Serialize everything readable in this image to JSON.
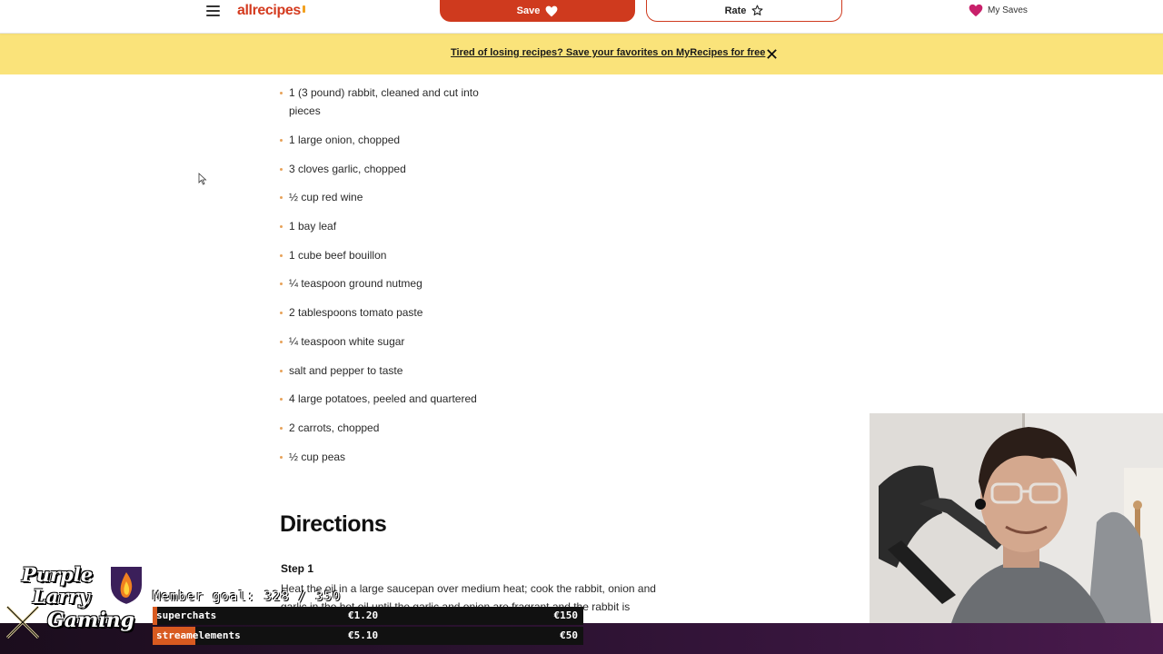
{
  "header": {
    "brand": "allrecipes",
    "save_label": "Save",
    "rate_label": "Rate",
    "my_saves_label": "My Saves"
  },
  "banner": {
    "text": "Tired of losing recipes? Save your favorites on MyRecipes for free"
  },
  "ingredients": [
    "1 (3 pound) rabbit, cleaned and cut into pieces",
    "1 large onion, chopped",
    "3 cloves garlic, chopped",
    "½ cup red wine",
    "1 bay leaf",
    "1 cube beef bouillon",
    "¼ teaspoon ground nutmeg",
    "2 tablespoons tomato paste",
    "¼ teaspoon white sugar",
    "salt and pepper to taste",
    "4 large potatoes, peeled and quartered",
    "2 carrots, chopped",
    "½ cup peas"
  ],
  "directions": {
    "title": "Directions",
    "step1_label": "Step 1",
    "step1_text": "Heat the oil in a large saucepan over medium heat; cook the rabbit, onion and garlic in the hot oil until the garlic and onion are fragrant and the rabbit is"
  },
  "stream": {
    "logo_line1": "Purple",
    "logo_line2": "Larry",
    "logo_line3": "Gaming",
    "member_goal": "Member goal: 328 / 350",
    "superchats_label": "superchats",
    "superchats_current": "€1.20",
    "superchats_goal": "€150",
    "superchats_progress": 0.01,
    "streamelements_label": "streamelements",
    "streamelements_current": "€5.10",
    "streamelements_goal": "€50",
    "streamelements_progress": 0.1
  },
  "colors": {
    "brand": "#d43b1f",
    "banner": "#fae37a",
    "bullet": "#e7a25a",
    "overlay_fill": "#d85a20"
  }
}
